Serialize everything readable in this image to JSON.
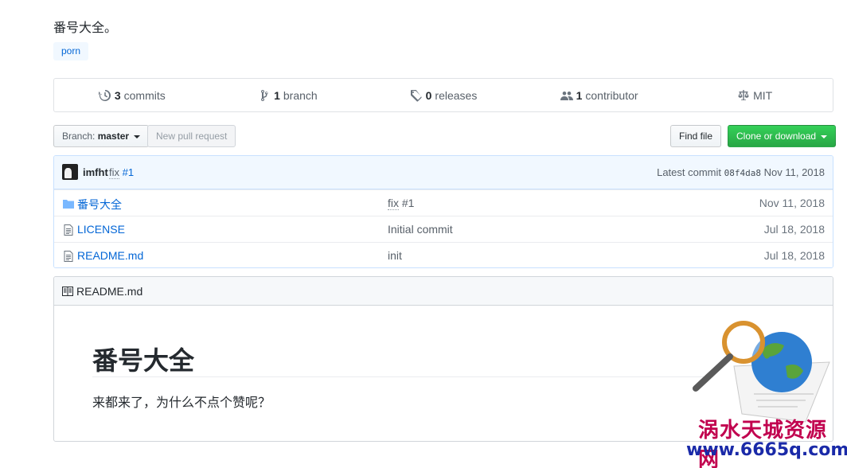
{
  "repo": {
    "description": "番号大全。",
    "topics": [
      "porn"
    ]
  },
  "summary": {
    "commits": {
      "count": "3",
      "label": "commits"
    },
    "branches": {
      "count": "1",
      "label": "branch"
    },
    "releases": {
      "count": "0",
      "label": "releases"
    },
    "contributors": {
      "count": "1",
      "label": "contributor"
    },
    "license": "MIT"
  },
  "toolbar": {
    "branch_label": "Branch:",
    "branch_name": "master",
    "new_pull_request": "New pull request",
    "find_file": "Find file",
    "clone_or_download": "Clone or download"
  },
  "latest_commit": {
    "author": "imfht",
    "message": "fix",
    "issue_ref": "#1",
    "label": "Latest commit",
    "sha": "08f4da8",
    "date": "Nov 11, 2018"
  },
  "files": [
    {
      "name": "番号大全",
      "type": "folder",
      "message": "fix",
      "message_ref": "#1",
      "age": "Nov 11, 2018"
    },
    {
      "name": "LICENSE",
      "type": "file",
      "message": "Initial commit",
      "message_ref": "",
      "age": "Jul 18, 2018"
    },
    {
      "name": "README.md",
      "type": "file",
      "message": "init",
      "message_ref": "",
      "age": "Jul 18, 2018"
    }
  ],
  "readme": {
    "filename": "README.md",
    "heading": "番号大全",
    "body": "来都来了，为什么不点个赞呢？"
  },
  "watermark": {
    "line1": "涡水天城资源网",
    "line2": "www.6665q.com"
  },
  "colors": {
    "link": "#0366d6",
    "clone_button": "#28a745",
    "commit_bar": "#f1f8ff"
  }
}
